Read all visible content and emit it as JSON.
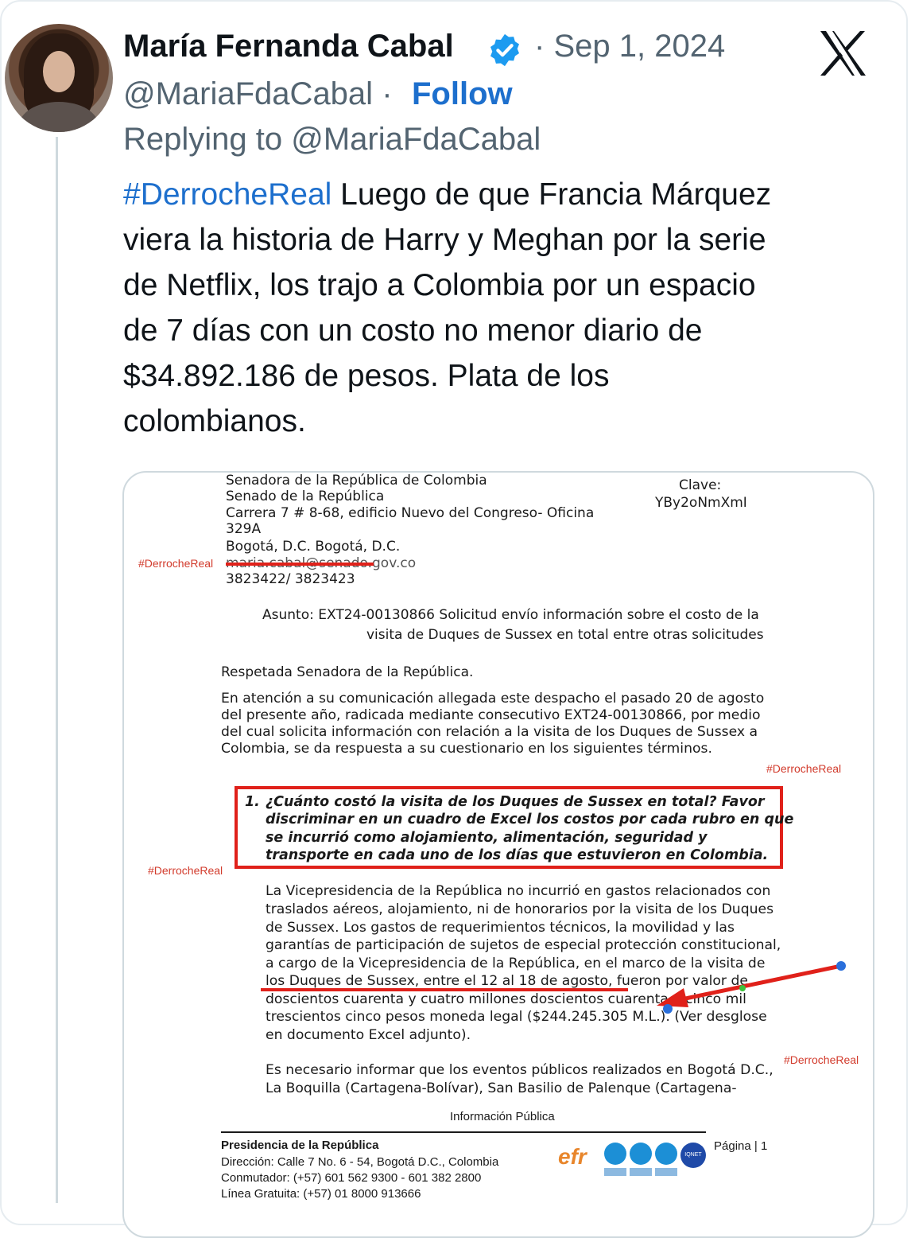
{
  "author": {
    "name": "María Fernanda Cabal",
    "handle": "@MariaFdaCabal",
    "separator": "·",
    "follow_label": "Follow",
    "date": "Sep 1, 2024",
    "replying_to": "Replying to @MariaFdaCabal"
  },
  "icons": {
    "verified": "verified-badge-icon",
    "platform": "x-logo-icon"
  },
  "colors": {
    "link": "#1d6fcd",
    "muted": "#536471",
    "text": "#0f1419",
    "annotation_red": "#e0211a",
    "marker_blue": "#2a6fdb"
  },
  "tweet": {
    "hashtag": "#DerrocheReal",
    "lines": [
      " Luego de que Francia Márquez",
      "viera la historia de Harry y Meghan por la serie",
      "de Netflix, los trajo a Colombia por un espacio",
      "de 7 días con un costo no menor diario de",
      "$34.892.186 de pesos. Plata de los",
      "colombianos."
    ]
  },
  "document": {
    "header_lines": [
      "Senadora de la República de Colombia",
      "Senado de la República",
      "Carrera 7 # 8-68, edificio Nuevo del Congreso- Oficina",
      "329A",
      "Bogotá, D.C. Bogotá, D.C.",
      "maria.cabal@senado.gov.co",
      "3823422/ 3823423"
    ],
    "clave_label": "Clave:",
    "clave_value": "YBy2oNmXmI",
    "watermark": "#DerrocheReal",
    "asunto_line1": "Asunto: EXT24-00130866 Solicitud envío información sobre el costo de la",
    "asunto_line2": "visita de Duques de Sussex en total entre otras solicitudes",
    "salutation": "Respetada Senadora de la República.",
    "intro_lines": [
      "En atención a su comunicación allegada este despacho el pasado 20 de agosto",
      "del presente año, radicada mediante consecutivo EXT24-00130866, por medio",
      "del cual solicita información con relación a la visita de los Duques de Sussex a",
      "Colombia, se da respuesta a su cuestionario en los siguientes términos."
    ],
    "question_number": "1.",
    "question_lines": [
      "¿Cuánto costó la visita de los Duques de Sussex en total? Favor",
      "discriminar en un cuadro de Excel los costos por cada rubro en que",
      "se   incurrió   como   alojamiento,   alimentación,   seguridad   y",
      "transporte en cada uno de los días que estuvieron en Colombia."
    ],
    "answer_lines": [
      "La Vicepresidencia de la República no incurrió en gastos relacionados con",
      "traslados aéreos, alojamiento, ni de honorarios por la visita de los Duques",
      "de Sussex. Los gastos de requerimientos técnicos, la movilidad y las",
      "garantías de participación de sujetos de especial protección constitucional,",
      "a cargo de la Vicepresidencia de la República, en el marco de la visita de",
      "los Duques de Sussex, entre el 12 al 18 de agosto, fueron por valor de",
      "doscientos cuarenta y cuatro millones doscientos cuarenta y cinco mil",
      "trescientos cinco pesos moneda legal ($244.245.305 M.L.). (Ver desglose",
      "en documento Excel adjunto)."
    ],
    "closing_lines": [
      "Es necesario informar que los eventos públicos realizados en Bogotá D.C.,",
      "La Boquilla (Cartagena-Bolívar), San Basilio de Palenque (Cartagena-"
    ],
    "classification": "Información  Pública",
    "footer": {
      "org": "Presidencia de la República",
      "address": "Dirección: Calle 7 No. 6 - 54, Bogotá D.C., Colombia",
      "phone": "Conmutador: (+57) 601 562 9300 - 601 382 2800",
      "toll_free": "Línea Gratuita: (+57) 01 8000 913666",
      "page": "Página | 1",
      "efr_logo": "efr",
      "iqnet_logo": "IQNET"
    }
  }
}
